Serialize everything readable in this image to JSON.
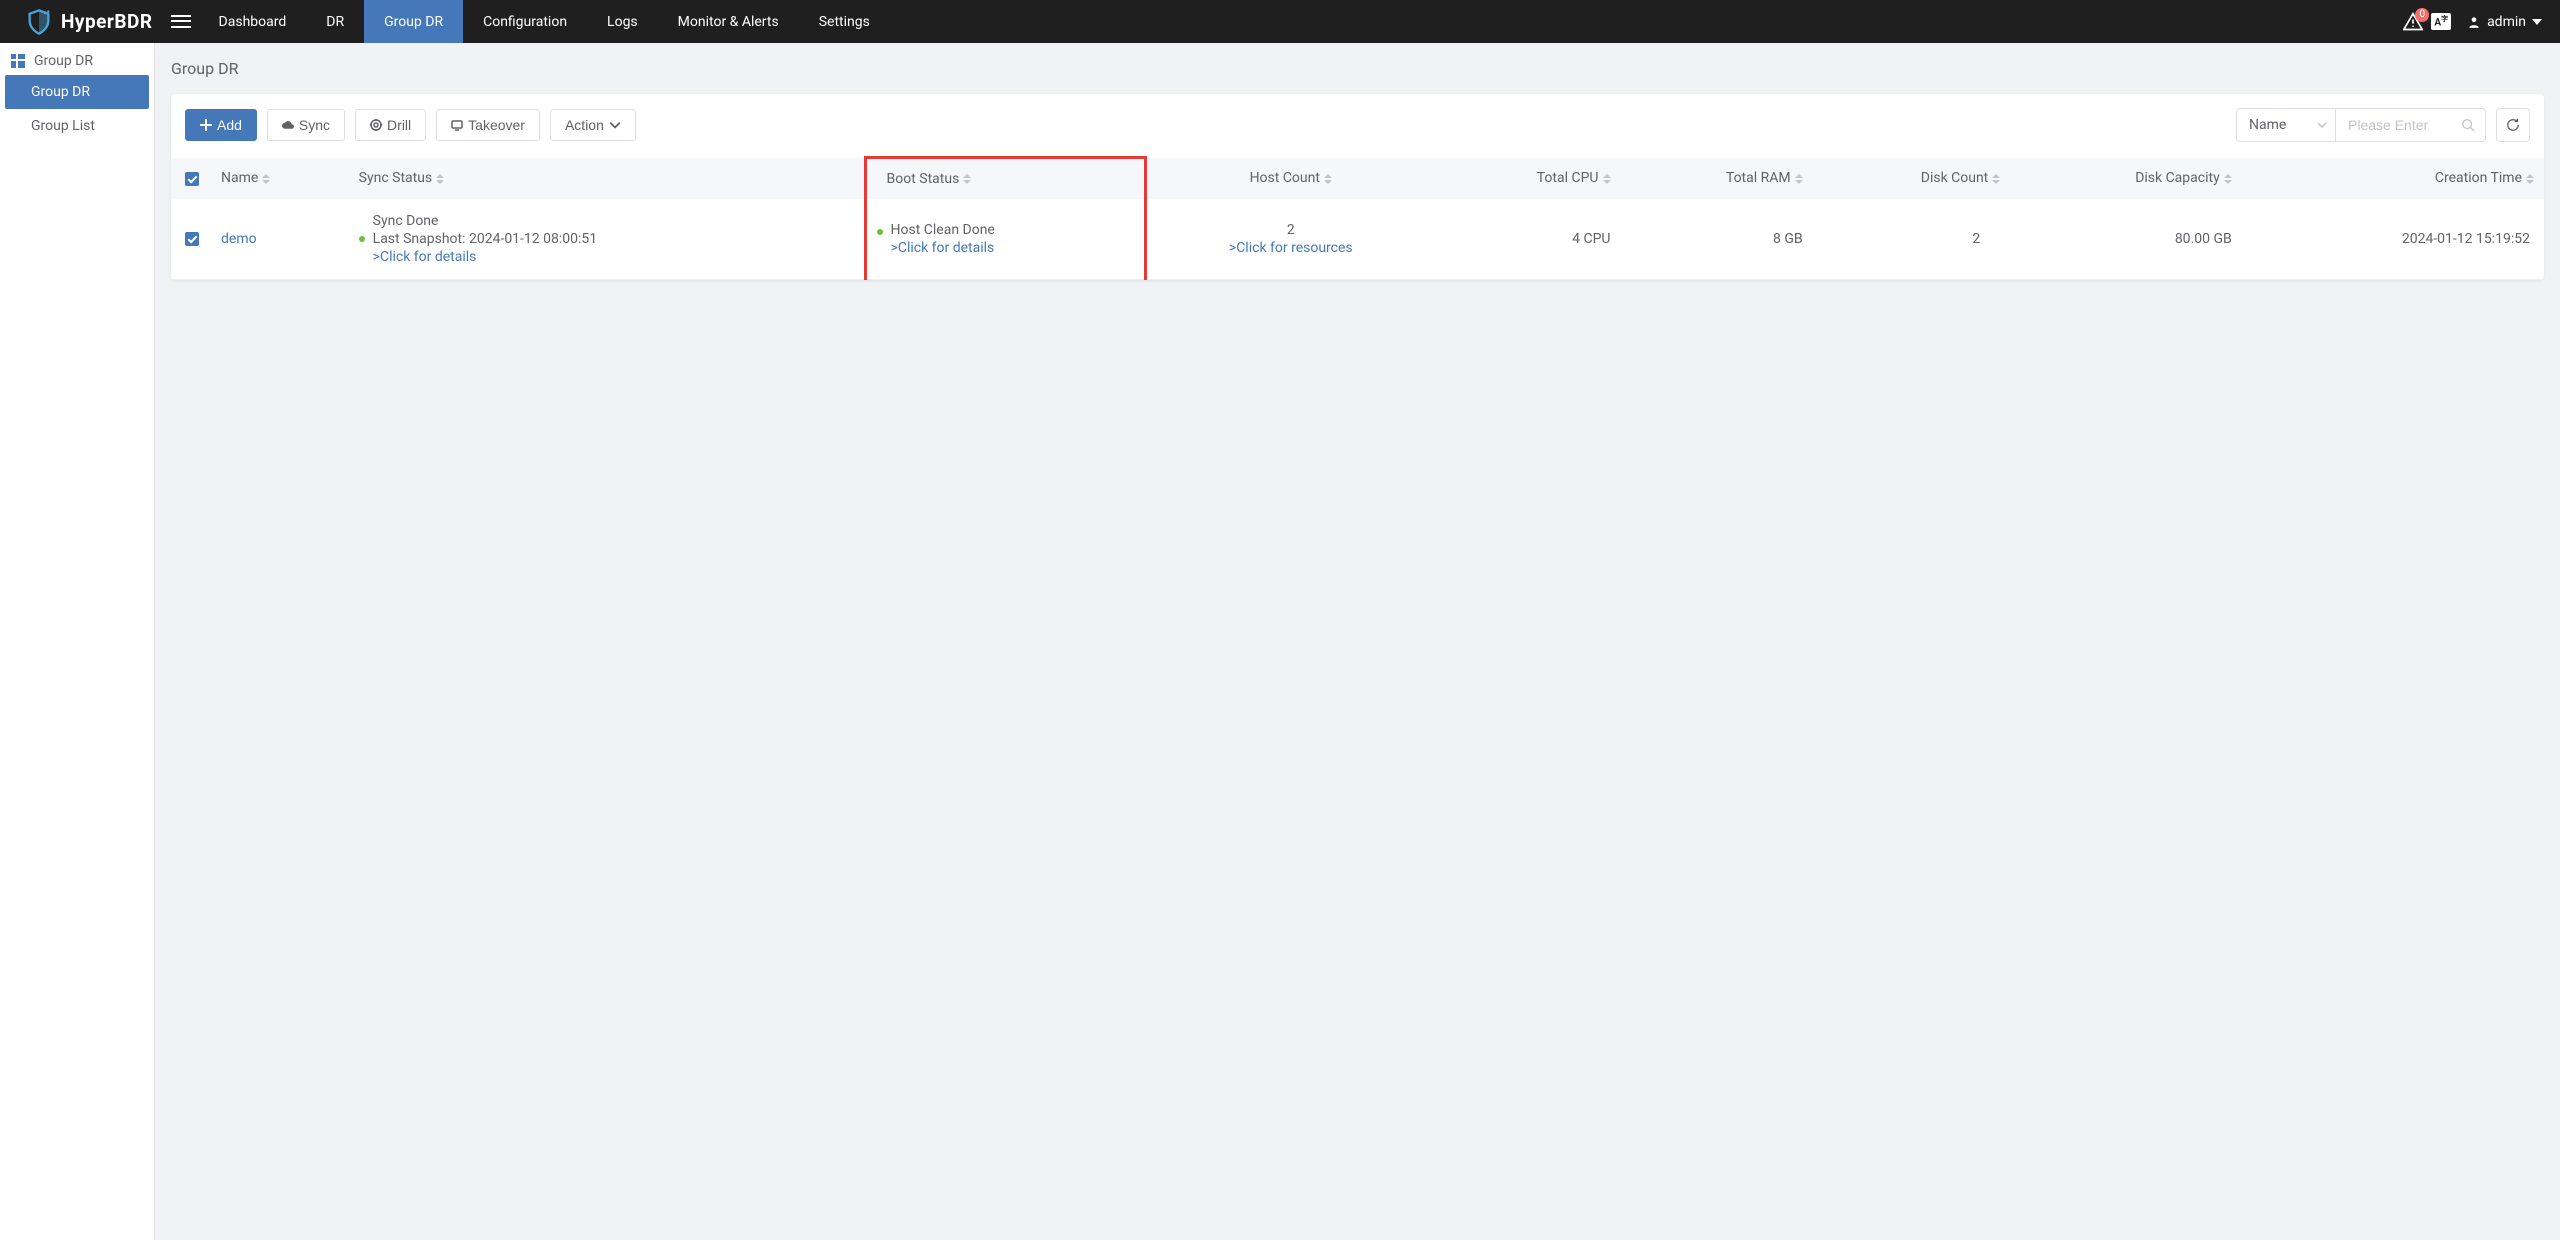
{
  "brand": {
    "name": "HyperBDR"
  },
  "topnav": {
    "items": [
      {
        "label": "Dashboard",
        "active": false
      },
      {
        "label": "DR",
        "active": false
      },
      {
        "label": "Group DR",
        "active": true
      },
      {
        "label": "Configuration",
        "active": false
      },
      {
        "label": "Logs",
        "active": false
      },
      {
        "label": "Monitor & Alerts",
        "active": false
      },
      {
        "label": "Settings",
        "active": false
      }
    ]
  },
  "header_right": {
    "alert_count": "0",
    "lang_badge": "A",
    "username": "admin"
  },
  "sidebar": {
    "section_label": "Group DR",
    "items": [
      {
        "label": "Group DR",
        "active": true
      },
      {
        "label": "Group List",
        "active": false
      }
    ]
  },
  "page": {
    "title": "Group DR"
  },
  "toolbar": {
    "add_label": "Add",
    "sync_label": "Sync",
    "drill_label": "Drill",
    "takeover_label": "Takeover",
    "action_label": "Action",
    "filter_field": "Name",
    "search_placeholder": "Please Enter"
  },
  "table": {
    "columns": {
      "name": "Name",
      "sync_status": "Sync Status",
      "boot_status": "Boot Status",
      "host_count": "Host Count",
      "total_cpu": "Total CPU",
      "total_ram": "Total RAM",
      "disk_count": "Disk Count",
      "disk_capacity": "Disk Capacity",
      "creation_time": "Creation Time"
    },
    "rows": [
      {
        "name": "demo",
        "sync_status_line1": "Sync Done",
        "sync_status_line2": "Last Snapshot: 2024-01-12 08:00:51",
        "sync_status_link": ">Click for details",
        "boot_status_line1": "Host Clean Done",
        "boot_status_link": ">Click for details",
        "host_count": "2",
        "host_count_link": ">Click for resources",
        "total_cpu": "4 CPU",
        "total_ram": "8 GB",
        "disk_count": "2",
        "disk_capacity": "80.00 GB",
        "creation_time": "2024-01-12 15:19:52"
      }
    ]
  }
}
